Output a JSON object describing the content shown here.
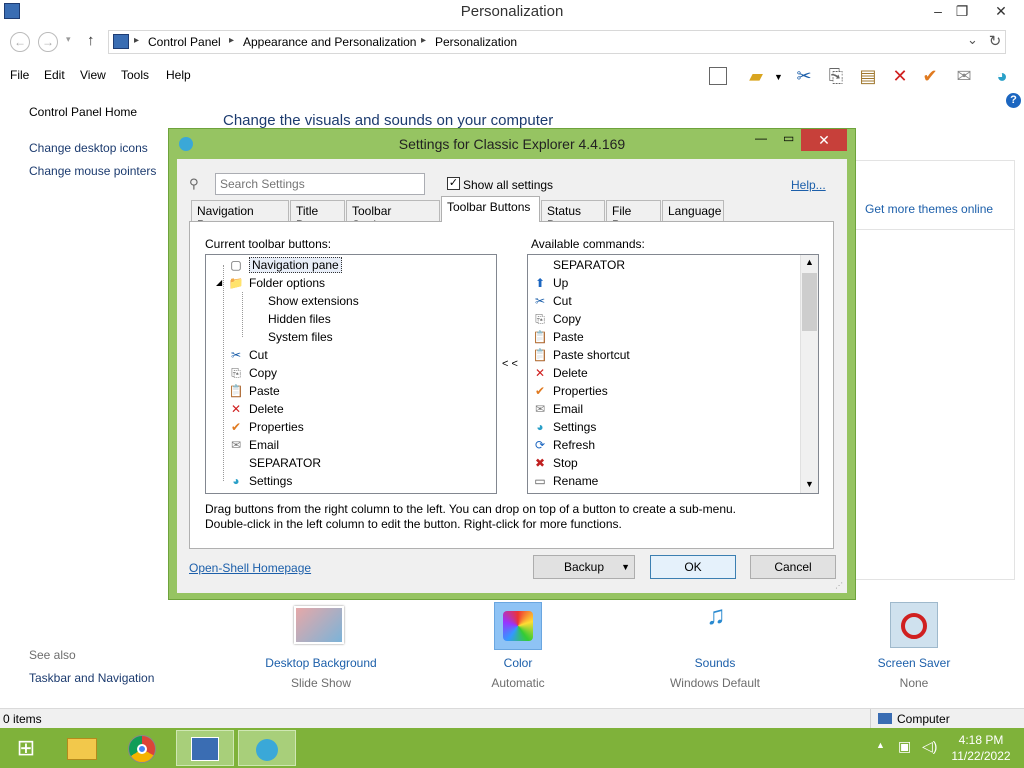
{
  "window": {
    "title": "Personalization",
    "min": "‒",
    "max": "❐",
    "close": "✕"
  },
  "address": {
    "back": "←",
    "forward": "→",
    "up": "↑",
    "dropdown": "⌄",
    "refresh": "↻",
    "crumbs": [
      "Control Panel",
      "Appearance and Personalization",
      "Personalization"
    ]
  },
  "menu": [
    "File",
    "Edit",
    "View",
    "Tools",
    "Help"
  ],
  "left_pane": {
    "home": "Control Panel Home",
    "links": [
      "Change desktop icons",
      "Change mouse pointers"
    ],
    "see_also": "See also",
    "see_also_links": [
      "Taskbar and Navigation"
    ]
  },
  "main": {
    "heading": "Change the visuals and sounds on your computer",
    "get_more_themes": "Get more themes online"
  },
  "dialog": {
    "title": "Settings for Classic Explorer 4.4.169",
    "search_placeholder": "Search Settings",
    "show_all": "Show all settings",
    "help": "Help...",
    "tabs": [
      "Navigation Pane",
      "Title Bar",
      "Toolbar Settings",
      "Toolbar Buttons",
      "Status Bar",
      "File Pane",
      "Language"
    ],
    "active_tab": "Toolbar Buttons",
    "current_label": "Current toolbar buttons:",
    "available_label": "Available commands:",
    "move_left": "< <",
    "current": [
      {
        "label": "Navigation pane",
        "icon": "nav-pane-icon",
        "glyph": "▢"
      },
      {
        "label": "Folder options",
        "icon": "folder-options-icon",
        "glyph": "📁"
      },
      {
        "label": "Show extensions",
        "icon": "",
        "glyph": ""
      },
      {
        "label": "Hidden files",
        "icon": "",
        "glyph": ""
      },
      {
        "label": "System files",
        "icon": "",
        "glyph": ""
      },
      {
        "label": "Cut",
        "icon": "cut-icon",
        "glyph": "✂"
      },
      {
        "label": "Copy",
        "icon": "copy-icon",
        "glyph": "⎘"
      },
      {
        "label": "Paste",
        "icon": "paste-icon",
        "glyph": "📋"
      },
      {
        "label": "Delete",
        "icon": "delete-icon",
        "glyph": "✕"
      },
      {
        "label": "Properties",
        "icon": "properties-icon",
        "glyph": "✔"
      },
      {
        "label": "Email",
        "icon": "email-icon",
        "glyph": "✉"
      },
      {
        "label": "SEPARATOR",
        "icon": "",
        "glyph": ""
      },
      {
        "label": "Settings",
        "icon": "settings-shell-icon",
        "glyph": "◕"
      }
    ],
    "available": [
      {
        "label": "SEPARATOR",
        "icon": "",
        "glyph": ""
      },
      {
        "label": "Up",
        "icon": "up-icon",
        "glyph": "⬆"
      },
      {
        "label": "Cut",
        "icon": "cut-icon",
        "glyph": "✂"
      },
      {
        "label": "Copy",
        "icon": "copy-icon",
        "glyph": "⎘"
      },
      {
        "label": "Paste",
        "icon": "paste-icon",
        "glyph": "📋"
      },
      {
        "label": "Paste shortcut",
        "icon": "paste-shortcut-icon",
        "glyph": "📋"
      },
      {
        "label": "Delete",
        "icon": "delete-icon",
        "glyph": "✕"
      },
      {
        "label": "Properties",
        "icon": "properties-icon",
        "glyph": "✔"
      },
      {
        "label": "Email",
        "icon": "email-icon",
        "glyph": "✉"
      },
      {
        "label": "Settings",
        "icon": "settings-shell-icon",
        "glyph": "◕"
      },
      {
        "label": "Refresh",
        "icon": "refresh-icon",
        "glyph": "⟳"
      },
      {
        "label": "Stop",
        "icon": "stop-icon",
        "glyph": "✖"
      },
      {
        "label": "Rename",
        "icon": "rename-icon",
        "glyph": "▭"
      }
    ],
    "hint1": "Drag buttons from the right column to the left. You can drop on top of a button to create a sub-menu.",
    "hint2": "Double-click in the left column to edit the button. Right-click for more functions.",
    "homepage": "Open-Shell Homepage",
    "backup": "Backup",
    "ok": "OK",
    "cancel": "Cancel"
  },
  "tiles": [
    {
      "title": "Desktop Background",
      "sub": "Slide Show"
    },
    {
      "title": "Color",
      "sub": "Automatic"
    },
    {
      "title": "Sounds",
      "sub": "Windows Default"
    },
    {
      "title": "Screen Saver",
      "sub": "None"
    }
  ],
  "status": {
    "items": "0 items",
    "computer": "Computer"
  },
  "taskbar": {
    "time": "4:18 PM",
    "date": "11/22/2022"
  },
  "colors": {
    "accent_green": "#7fb23a",
    "dialog_border": "#96c462",
    "link": "#1c5faa",
    "close_red": "#c7403a"
  }
}
